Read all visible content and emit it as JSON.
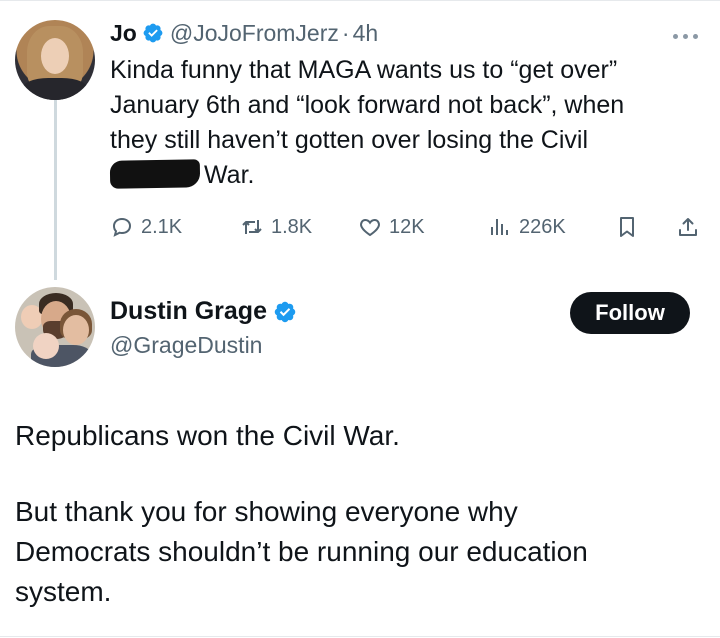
{
  "original_post": {
    "author_name": "Jo",
    "handle": "@JoJoFromJerz",
    "separator": "·",
    "time": "4h",
    "text_lines": [
      "Kinda funny that MAGA wants us to “get over”",
      "January 6th and “look forward not back”, when",
      "they still haven’t gotten over losing the Civil",
      "War."
    ],
    "stats": {
      "replies": "2.1K",
      "reposts": "1.8K",
      "likes": "12K",
      "views": "226K"
    },
    "icons": {
      "verified": "verified-badge-icon",
      "more": "more-icon",
      "reply": "reply-icon",
      "repost": "repost-icon",
      "like": "heart-icon",
      "views": "views-icon",
      "bookmark": "bookmark-icon",
      "share": "share-icon"
    }
  },
  "reply_post": {
    "author_name": "Dustin Grage",
    "handle": "@GrageDustin",
    "follow_label": "Follow",
    "paragraphs": [
      [
        "Republicans won the Civil War."
      ],
      [
        "But thank you for showing everyone why",
        "Democrats shouldn’t be running our education",
        "system."
      ]
    ]
  },
  "colors": {
    "text": "#0f1419",
    "secondary_text": "#536471",
    "verified_blue": "#1d9bf0",
    "follow_button_bg": "#0f1419",
    "thread_line": "#cfd9de"
  }
}
